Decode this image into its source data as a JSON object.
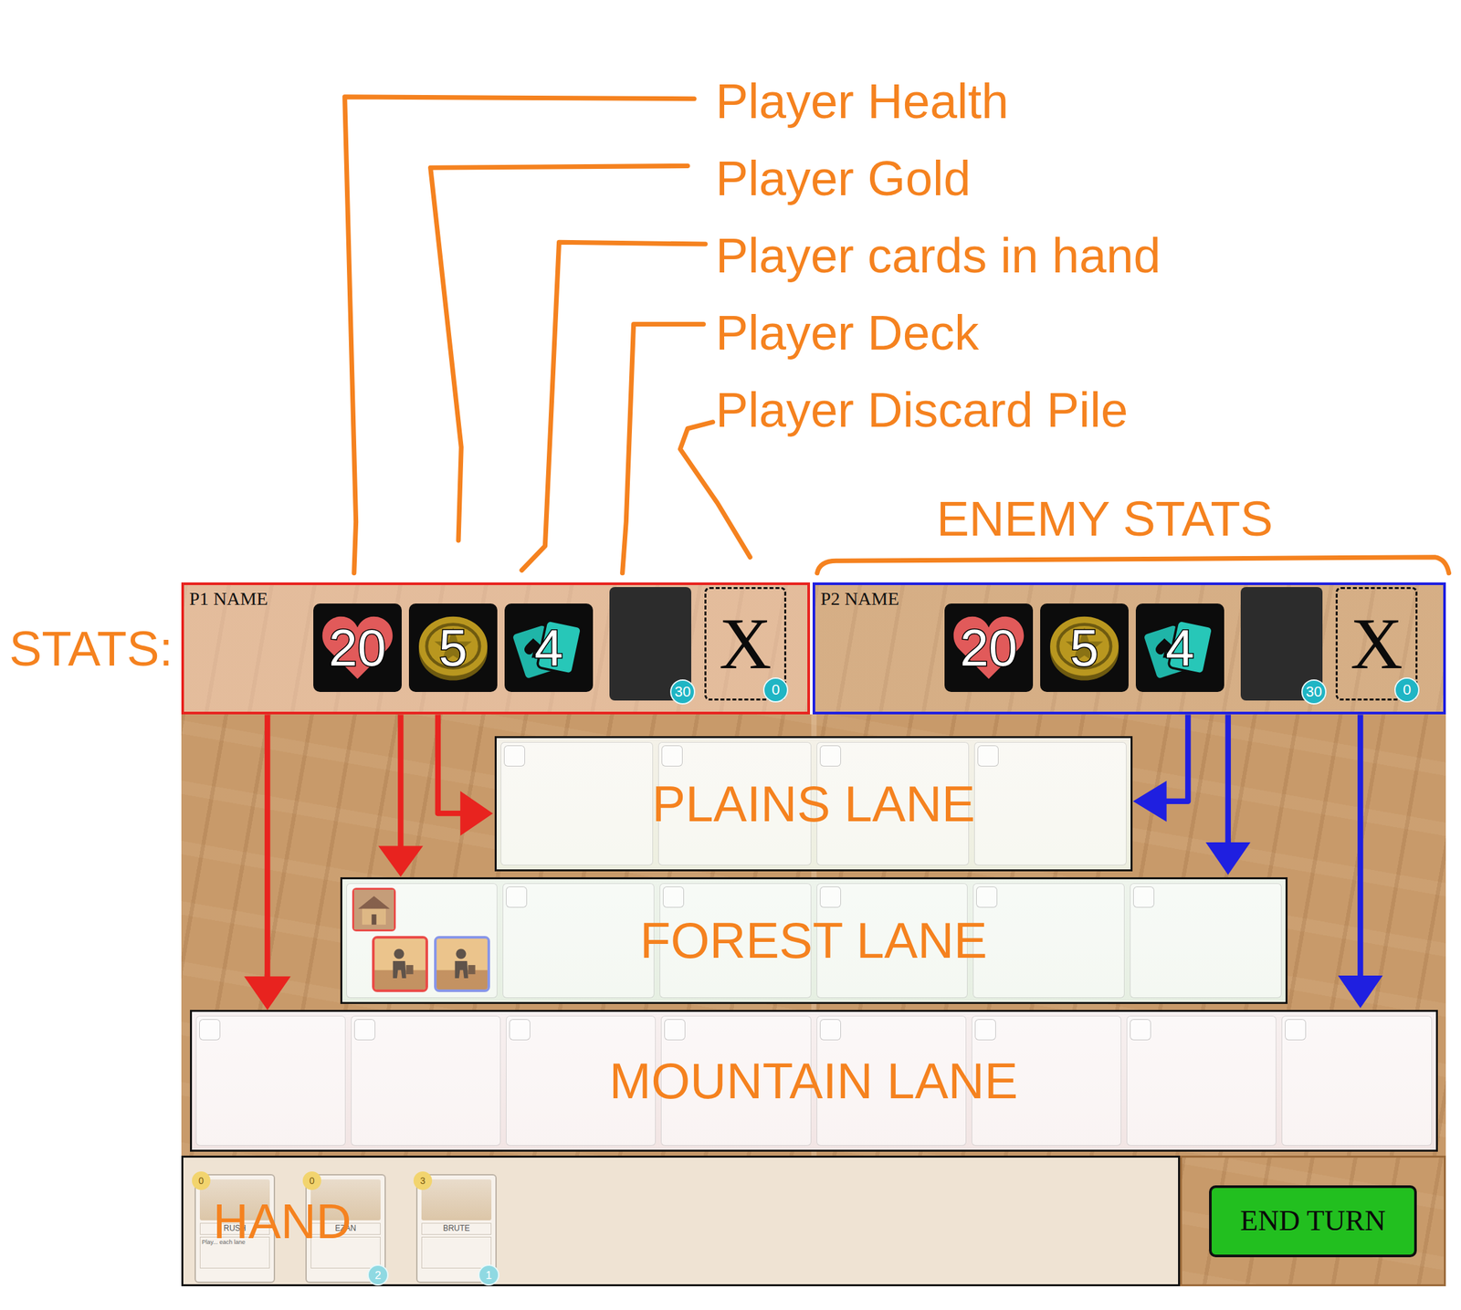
{
  "annotations": {
    "labels": [
      "Player Health",
      "Player Gold",
      "Player cards in hand",
      "Player Deck",
      "Player Discard Pile"
    ],
    "enemy_stats": "ENEMY STATS",
    "stats": "STATS:"
  },
  "players": [
    {
      "name": "P1 NAME",
      "health": "20",
      "gold": "5",
      "hand": "4",
      "deck": "30",
      "discard_mark": "X",
      "discard": "0",
      "color": "#e8231f"
    },
    {
      "name": "P2 NAME",
      "health": "20",
      "gold": "5",
      "hand": "4",
      "deck": "30",
      "discard_mark": "X",
      "discard": "0",
      "color": "#1f1fe0"
    }
  ],
  "lanes": [
    {
      "label": "PLAINS LANE",
      "kind": "plains",
      "slots": [
        {
          "units": []
        },
        {
          "units": []
        },
        {
          "units": []
        },
        {
          "units": []
        }
      ]
    },
    {
      "label": "FOREST LANE",
      "kind": "forest",
      "slots": [
        {
          "units": [
            {
              "kind": "building",
              "color": "#e8231f"
            },
            {
              "kind": "unit",
              "color": "#e8231f"
            },
            {
              "kind": "unit",
              "color": "#6f7fe6"
            }
          ]
        },
        {
          "units": []
        },
        {
          "units": []
        },
        {
          "units": []
        },
        {
          "units": []
        },
        {
          "units": []
        }
      ]
    },
    {
      "label": "MOUNTAIN LANE",
      "kind": "mountain",
      "slots": [
        {
          "units": []
        },
        {
          "units": []
        },
        {
          "units": []
        },
        {
          "units": []
        },
        {
          "units": []
        },
        {
          "units": []
        },
        {
          "units": []
        },
        {
          "units": []
        }
      ]
    }
  ],
  "hand": {
    "label": "HAND",
    "cards": [
      {
        "name": "RUSH",
        "cost": "0",
        "text": "Play... each lane"
      },
      {
        "name": "EZAN",
        "cost": "0",
        "count": "2"
      },
      {
        "name": "BRUTE",
        "cost": "3",
        "count": "1"
      }
    ]
  },
  "end_turn": "END TURN"
}
